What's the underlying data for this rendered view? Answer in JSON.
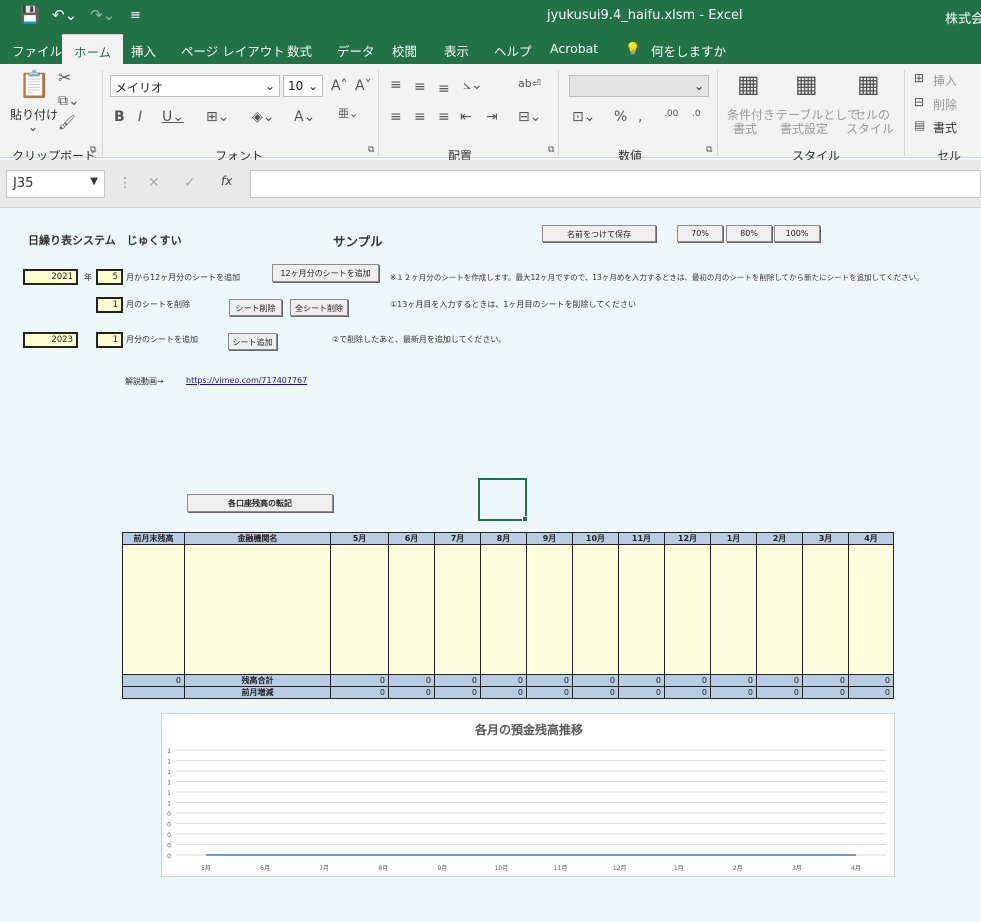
{
  "titlebar": {
    "filename": "jyukusui9.4_haifu.xlsm",
    "separator": " - ",
    "app": "Excel",
    "right": "株式会"
  },
  "tabs": [
    "ファイル",
    "ホーム",
    "挿入",
    "ページ レイアウト",
    "数式",
    "データ",
    "校閲",
    "表示",
    "ヘルプ",
    "Acrobat",
    "何をしますか"
  ],
  "ribbon": {
    "clipboard": {
      "paste": "貼り付け",
      "group": "クリップボード"
    },
    "font": {
      "name": "メイリオ",
      "size": "10",
      "group": "フォント"
    },
    "align": {
      "group": "配置"
    },
    "number": {
      "group": "数値"
    },
    "style": {
      "cond1": "条件付き",
      "cond2": "書式",
      "table1": "テーブルとして",
      "table2": "書式設定",
      "cell1": "セルの",
      "cell2": "スタイル",
      "group": "スタイル"
    },
    "cells": {
      "insert": "挿入",
      "delete": "削除",
      "format": "書式",
      "group": "セル"
    }
  },
  "formula": {
    "namebox": "J35",
    "fx": "fx",
    "value": ""
  },
  "sheet": {
    "heading": "日繰り表システム　じゅくすい",
    "sample": "サンプル",
    "save_btn": "名前をつけて保存",
    "zoom": [
      "70%",
      "80%",
      "100%"
    ],
    "year1": "2021",
    "year_label": "年",
    "month1": "5",
    "add12_label": "月から12ヶ月分のシートを追加",
    "add12_btn": "12ヶ月分のシートを追加",
    "note1": "※１２ヶ月分のシートを作成します。最大12ヶ月ですので、13ヶ月めを入力するときは、最初の月のシートを削除してから新たにシートを追加してください。",
    "del_month": "1",
    "del_label": "月のシートを削除",
    "del_btn": "シート削除",
    "delall_btn": "全シート削除",
    "note2": "①13ヶ月目を入力するときは、1ヶ月目のシートを削除してください",
    "year2": "2023",
    "month2": "1",
    "add_label": "月分のシートを追加",
    "add_btn": "シート追加",
    "note3": "②で削除したあと、最新月を追加してください。",
    "video_label": "解説動画→",
    "video_url": "https://vimeo.com/717407767",
    "transfer_btn": "各口座残高の転記"
  },
  "table": {
    "headers": [
      "前月末残高",
      "金融機関名",
      "5月",
      "6月",
      "7月",
      "8月",
      "9月",
      "10月",
      "11月",
      "12月",
      "1月",
      "2月",
      "3月",
      "4月"
    ],
    "total_label": "残高合計",
    "diff_label": "前月増減",
    "prev_total": "0",
    "totals": [
      "0",
      "0",
      "0",
      "0",
      "0",
      "0",
      "0",
      "0",
      "0",
      "0",
      "0",
      "0"
    ],
    "diffs": [
      "0",
      "0",
      "0",
      "0",
      "0",
      "0",
      "0",
      "0",
      "0",
      "0",
      "0",
      "0"
    ]
  },
  "chart_data": {
    "type": "line",
    "title": "各月の預金残高推移",
    "categories": [
      "5月",
      "6月",
      "7月",
      "8月",
      "9月",
      "10月",
      "11月",
      "12月",
      "1月",
      "2月",
      "3月",
      "4月"
    ],
    "y_tick_labels": [
      "1",
      "1",
      "1",
      "1",
      "1",
      "1",
      "0",
      "0",
      "0",
      "0",
      "0"
    ],
    "series": [
      {
        "values": [
          0,
          0,
          0,
          0,
          0,
          0,
          0,
          0,
          0,
          0,
          0,
          0
        ]
      }
    ],
    "grid": true,
    "color": "#4472c4"
  }
}
